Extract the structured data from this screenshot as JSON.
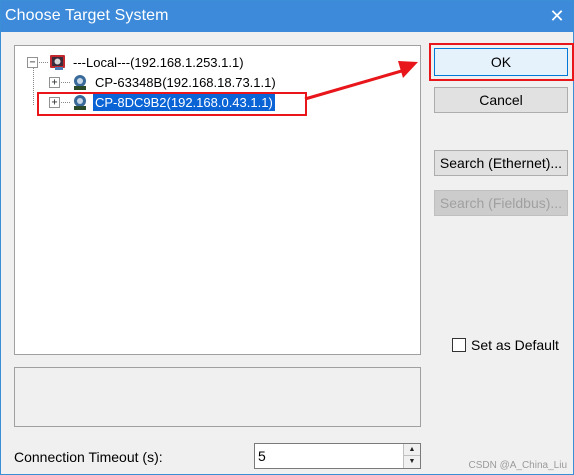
{
  "window": {
    "title": "Choose Target System"
  },
  "tree": {
    "root": {
      "toggle": "⊟",
      "name": "---Local---",
      "address": "(192.168.1.253.1.1)"
    },
    "children": [
      {
        "toggle": "⊞",
        "name": "CP-63348B",
        "address": "(192.168.18.73.1.1)"
      },
      {
        "toggle": "⊞",
        "name": "CP-8DC9B2",
        "address": "(192.168.0.43.1.1)",
        "selected": true
      }
    ]
  },
  "buttons": {
    "ok": "OK",
    "cancel": "Cancel",
    "search_ethernet": "Search (Ethernet)...",
    "search_fieldbus": "Search (Fieldbus)..."
  },
  "set_default": {
    "label": "Set as Default",
    "checked": false
  },
  "timeout": {
    "label": "Connection Timeout (s):",
    "value": "5"
  },
  "watermark": "CSDN @A_China_Liu",
  "colors": {
    "title_bar": "#3c8ad9",
    "selection": "#0a64d6",
    "annotation_red": "#e8161b"
  },
  "icons": {
    "close": "close-icon",
    "network_node": "network-node-icon"
  }
}
